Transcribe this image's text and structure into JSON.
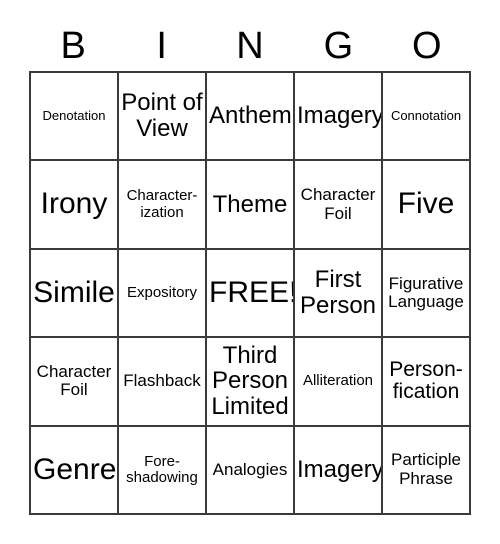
{
  "card": {
    "header_letters": [
      "B",
      "I",
      "N",
      "G",
      "O"
    ],
    "border_color": "#3a3a3a",
    "background_color": "#ffffff",
    "text_color": "#000000",
    "rows": [
      [
        {
          "label": "Denotation",
          "size": "xs"
        },
        {
          "label": "Point of\nView",
          "size": "xl"
        },
        {
          "label": "Anthem",
          "size": "xl"
        },
        {
          "label": "Imagery",
          "size": "xl"
        },
        {
          "label": "Connotation",
          "size": "xs"
        }
      ],
      [
        {
          "label": "Irony",
          "size": "xxl"
        },
        {
          "label": "Character-\nization",
          "size": "sm"
        },
        {
          "label": "Theme",
          "size": "xl"
        },
        {
          "label": "Character\nFoil",
          "size": "md"
        },
        {
          "label": "Five",
          "size": "xxl"
        }
      ],
      [
        {
          "label": "Simile",
          "size": "xxl"
        },
        {
          "label": "Expository",
          "size": "sm"
        },
        {
          "label": "FREE!",
          "size": "xxl"
        },
        {
          "label": "First\nPerson",
          "size": "xl"
        },
        {
          "label": "Figurative\nLanguage",
          "size": "md"
        }
      ],
      [
        {
          "label": "Character\nFoil",
          "size": "md"
        },
        {
          "label": "Flashback",
          "size": "md"
        },
        {
          "label": "Third\nPerson\nLimited",
          "size": "xl"
        },
        {
          "label": "Alliteration",
          "size": "sm"
        },
        {
          "label": "Person-\nfication",
          "size": "lg"
        }
      ],
      [
        {
          "label": "Genre",
          "size": "xxl"
        },
        {
          "label": "Fore-\nshadowing",
          "size": "sm"
        },
        {
          "label": "Analogies",
          "size": "md"
        },
        {
          "label": "Imagery",
          "size": "xl"
        },
        {
          "label": "Participle\nPhrase",
          "size": "md"
        }
      ]
    ]
  }
}
